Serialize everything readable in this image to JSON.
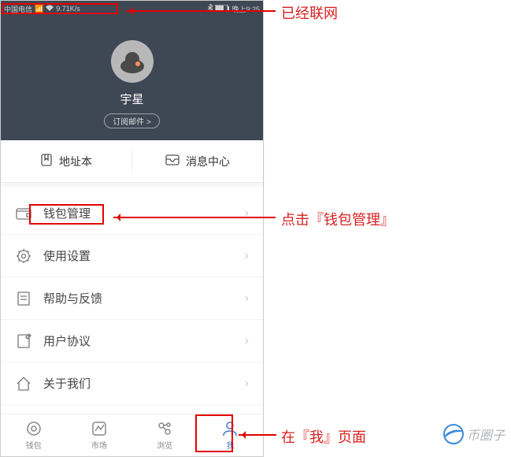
{
  "statusBar": {
    "carrier": "中国电信",
    "speed": "9.71K/s",
    "rightText": "晚上9:25"
  },
  "profile": {
    "username": "宇星",
    "subscribe": "订阅邮件 >"
  },
  "quick": {
    "addressBook": "地址本",
    "messageCenter": "消息中心"
  },
  "menu": {
    "walletManage": "钱包管理",
    "settings": "使用设置",
    "help": "帮助与反馈",
    "agreement": "用户协议",
    "about": "关于我们"
  },
  "tabs": {
    "wallet": "钱包",
    "market": "市场",
    "browse": "浏览",
    "me": "我"
  },
  "annotations": {
    "connected": "已经联网",
    "clickWallet": "点击『钱包管理』",
    "onMePage": "在『我』页面"
  },
  "watermark": "币圈子"
}
